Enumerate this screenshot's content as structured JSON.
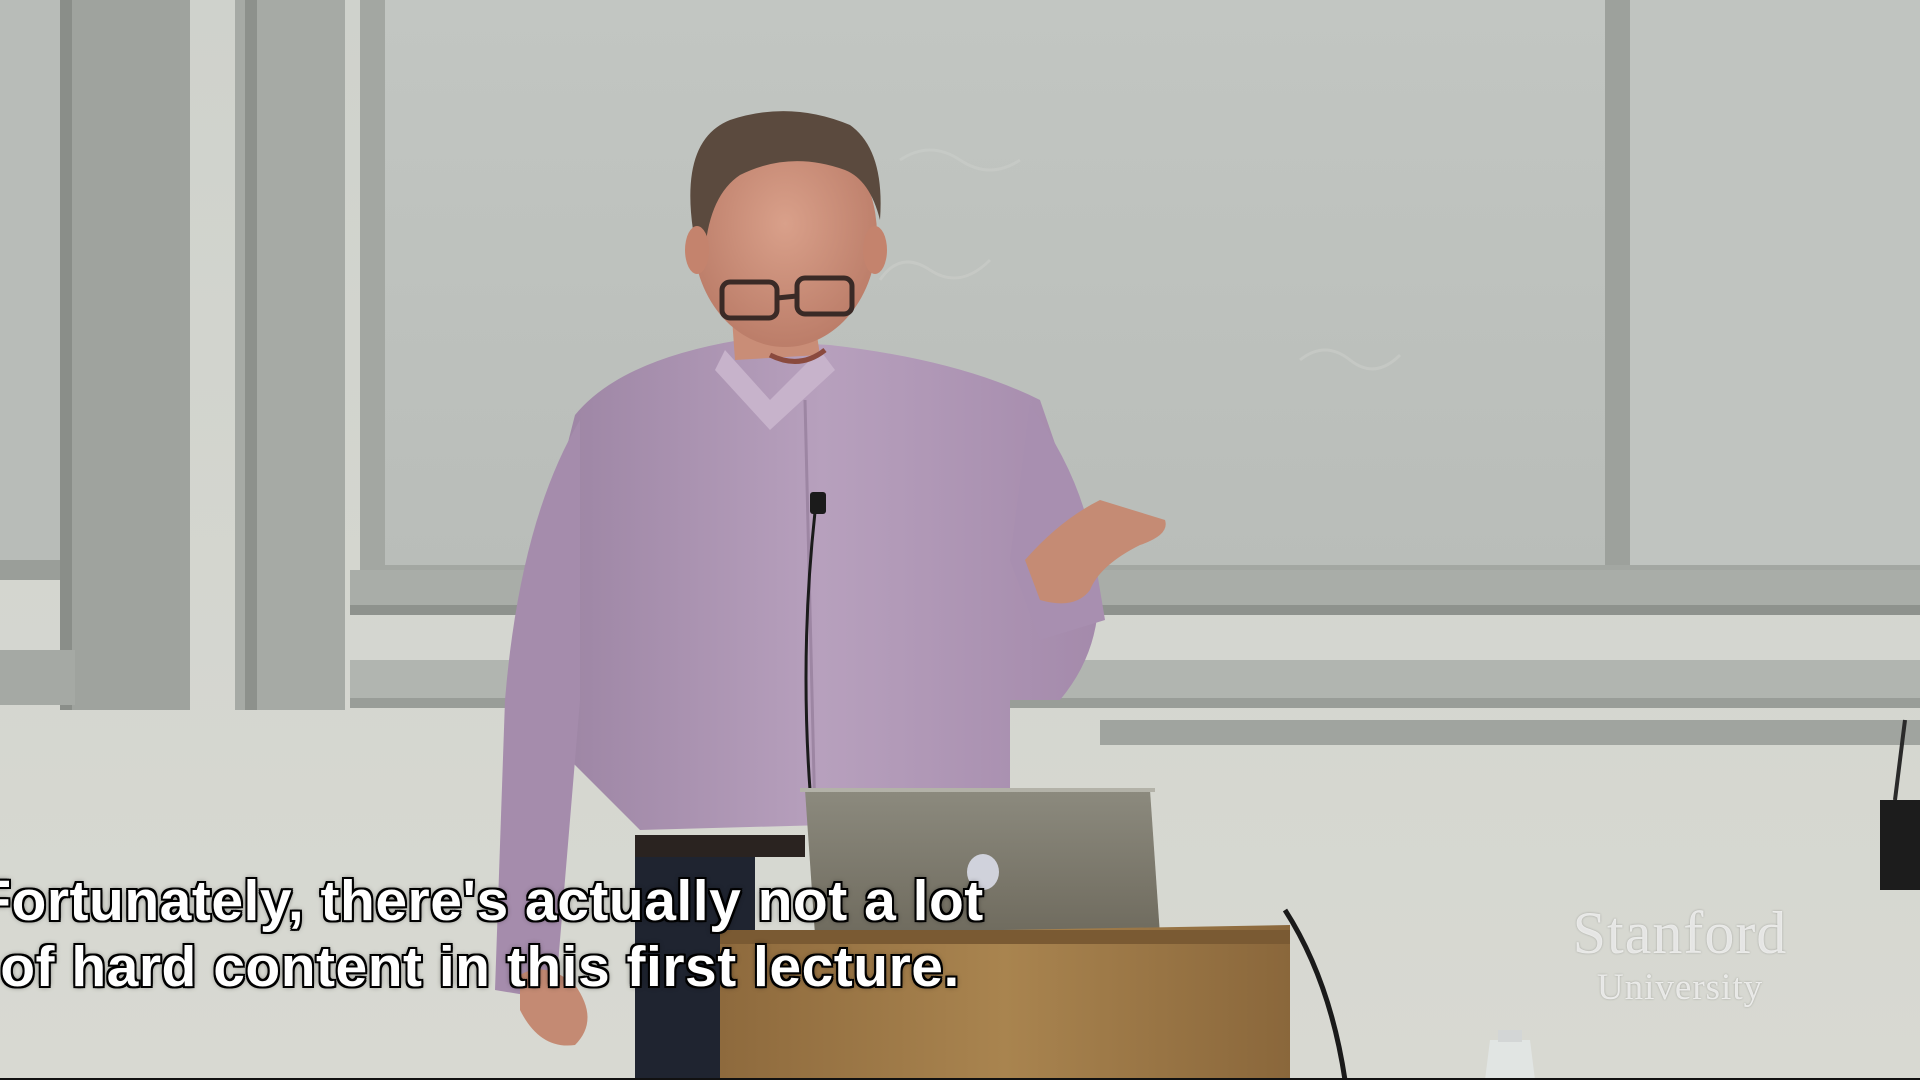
{
  "video": {
    "subtitle_lines": [
      "Fortunately, there's actually not a lot",
      "of hard content in this first lecture."
    ],
    "watermark": {
      "line1": "Stanford",
      "line2": "University"
    }
  },
  "colors": {
    "wall": "#c9ccc6",
    "board": "#bfc3bf",
    "shirt": "#b39ab8",
    "podium": "#a07b4a",
    "subtitle_text": "#ffffff",
    "subtitle_outline": "#000000"
  }
}
